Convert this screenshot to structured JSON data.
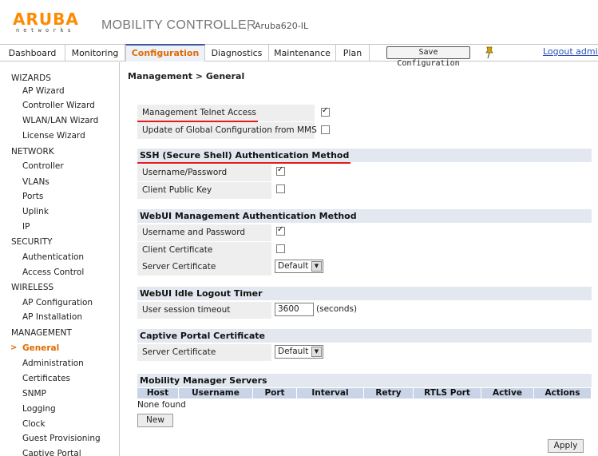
{
  "header": {
    "logo_word": "ARUBA",
    "logo_sub": "networks",
    "product": "MOBILITY CONTROLLER",
    "separator": "|",
    "host": "Aruba620-IL"
  },
  "tabs": [
    {
      "label": "Dashboard"
    },
    {
      "label": "Monitoring"
    },
    {
      "label": "Configuration",
      "active": true
    },
    {
      "label": "Diagnostics"
    },
    {
      "label": "Maintenance"
    },
    {
      "label": "Plan"
    }
  ],
  "toolbar": {
    "save_label": "Save Configuration",
    "logout_label": "Logout admin"
  },
  "sidebar": {
    "sections": [
      {
        "title": "WIZARDS",
        "items": [
          "AP Wizard",
          "Controller Wizard",
          "WLAN/LAN Wizard",
          "License Wizard"
        ]
      },
      {
        "title": "NETWORK",
        "items": [
          "Controller",
          "VLANs",
          "Ports",
          "Uplink",
          "IP"
        ]
      },
      {
        "title": "SECURITY",
        "items": [
          "Authentication",
          "Access Control"
        ]
      },
      {
        "title": "WIRELESS",
        "items": [
          "AP Configuration",
          "AP Installation"
        ]
      },
      {
        "title": "MANAGEMENT",
        "items": [
          "General",
          "Administration",
          "Certificates",
          "SNMP",
          "Logging",
          "Clock",
          "Guest Provisioning",
          "Captive Portal"
        ]
      }
    ],
    "active_item": "General",
    "active_marker": ">"
  },
  "main": {
    "title": "Management > General",
    "telnet_label": "Management Telnet Access",
    "telnet_checked": true,
    "mms_label": "Update of Global Configuration from MMS",
    "mms_checked": false,
    "ssh": {
      "header": "SSH (Secure Shell) Authentication Method",
      "user_pass_label": "Username/Password",
      "user_pass_checked": true,
      "client_key_label": "Client Public Key",
      "client_key_checked": false
    },
    "webui_auth": {
      "header": "WebUI Management Authentication Method",
      "user_pass_label": "Username and Password",
      "user_pass_checked": true,
      "client_cert_label": "Client Certificate",
      "client_cert_checked": false,
      "server_cert_label": "Server Certificate",
      "server_cert_value": "Default"
    },
    "idle": {
      "header": "WebUI Idle Logout Timer",
      "timeout_label": "User session timeout",
      "timeout_value": "3600",
      "timeout_unit": "(seconds)"
    },
    "captive": {
      "header": "Captive Portal Certificate",
      "server_cert_label": "Server Certificate",
      "server_cert_value": "Default"
    },
    "mms": {
      "header": "Mobility Manager Servers",
      "columns": [
        "Host",
        "Username",
        "Port",
        "Interval",
        "Retry",
        "RTLS Port",
        "Active",
        "Actions"
      ],
      "empty_text": "None found",
      "new_label": "New"
    },
    "apply_label": "Apply"
  },
  "colors": {
    "accent": "#e06a00",
    "section_bg": "#e3e8f0",
    "table_header_bg": "#c9d4e6",
    "highlight_underline": "#e21b1b",
    "link": "#2a4fb8"
  }
}
